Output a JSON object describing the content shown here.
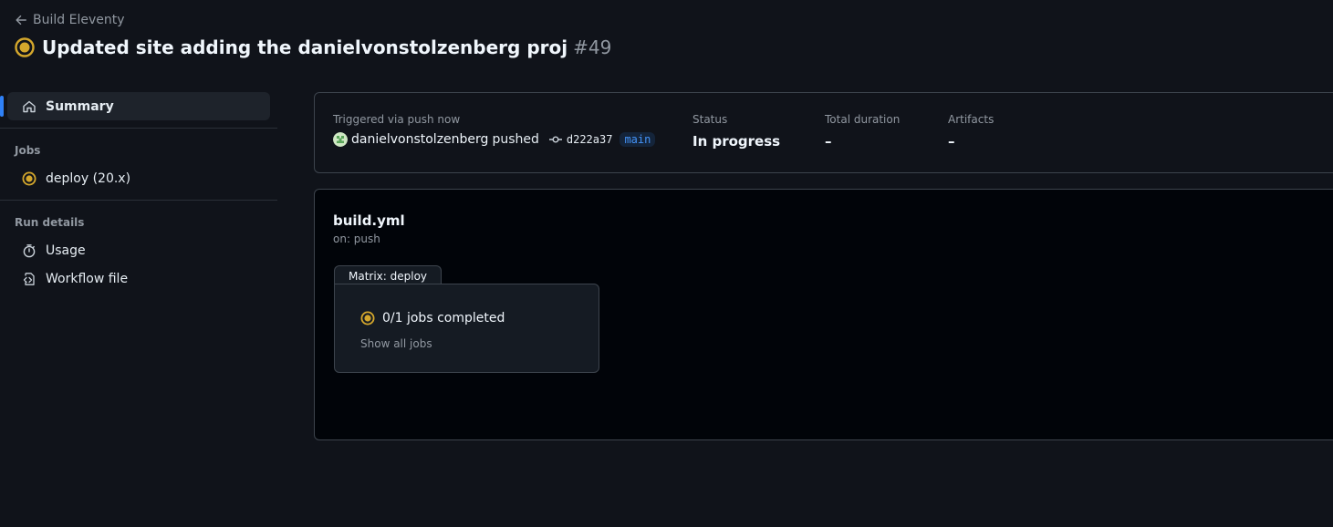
{
  "header": {
    "back_label": "Build Eleventy",
    "run_title": "Updated site adding the danielvonstolzenberg proj",
    "run_number": "#49"
  },
  "sidebar": {
    "summary_label": "Summary",
    "jobs_heading": "Jobs",
    "jobs": [
      {
        "label": "deploy (20.x)"
      }
    ],
    "run_details_heading": "Run details",
    "run_details": [
      {
        "label": "Usage"
      },
      {
        "label": "Workflow file"
      }
    ]
  },
  "summary": {
    "trigger_label": "Triggered via push now",
    "actor": "danielvonstolzenberg",
    "action": "pushed",
    "commit_sha": "d222a37",
    "branch": "main",
    "status_label": "Status",
    "status_value": "In progress",
    "duration_label": "Total duration",
    "duration_value": "–",
    "artifacts_label": "Artifacts",
    "artifacts_value": "–"
  },
  "graph": {
    "workflow_file": "build.yml",
    "trigger": "on: push",
    "matrix_title": "Matrix: deploy",
    "jobs_completed": "0/1 jobs completed",
    "show_all_jobs": "Show all jobs"
  },
  "colors": {
    "in_progress": "#d4a72c",
    "accent": "#2f81f7",
    "background": "#10131a"
  },
  "icons": {
    "back": "arrow-left-icon",
    "status": "in-progress-icon",
    "summary": "home-icon",
    "usage": "stopwatch-icon",
    "workflow_file": "file-code-icon",
    "commit": "git-commit-icon"
  }
}
